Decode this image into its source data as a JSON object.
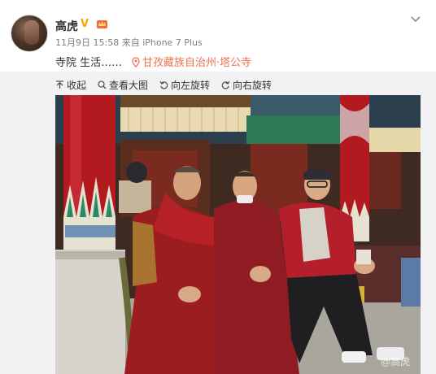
{
  "user": {
    "name": "高虎",
    "verified_badge": "V"
  },
  "post": {
    "date": "11月9日 15:58",
    "source": "来自 iPhone 7 Plus",
    "text": "寺院 生活……",
    "location": "甘孜藏族自治州·塔公寺"
  },
  "toolbar": {
    "items": [
      {
        "label": "收起",
        "icon": "collapse-icon"
      },
      {
        "label": "查看大图",
        "icon": "search-icon"
      },
      {
        "label": "向左旋转",
        "icon": "rotate-left-icon"
      },
      {
        "label": "向右旋转",
        "icon": "rotate-right-icon"
      }
    ]
  },
  "photo": {
    "watermark": "@高虎"
  },
  "colors": {
    "location": "#eb7350",
    "badge": "#f7a600",
    "robe": "#9c1d1f",
    "pillar": "#b21a1f"
  }
}
